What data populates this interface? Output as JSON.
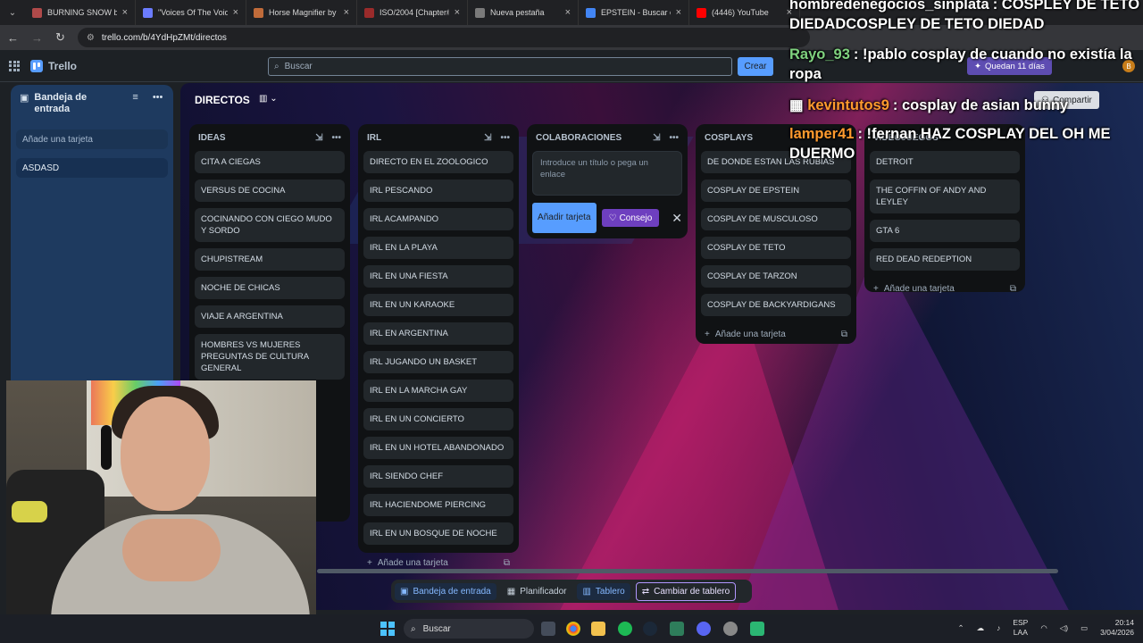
{
  "browser": {
    "tabs": [
      {
        "label": "BURNING SNOW by",
        "color": "#b04a4a"
      },
      {
        "label": "\"Voices Of The Void\"",
        "color": "#6b7cff"
      },
      {
        "label": "Horse Magnifier by w",
        "color": "#c06b3a"
      },
      {
        "label": "ISO/2004 [Chapter#1",
        "color": "#9a2b2b"
      },
      {
        "label": "Nueva pestaña",
        "color": "#7a7a7a"
      },
      {
        "label": "EPSTEIN - Buscar con",
        "color": "#4285f4"
      },
      {
        "label": "(4446) YouTube",
        "color": "#ff0000"
      }
    ],
    "url": "trello.com/b/4YdHpZMt/directos"
  },
  "trello": {
    "brand": "Trello",
    "search_placeholder": "Buscar",
    "create_label": "Crear",
    "trial_label": "Quedan 11 días",
    "share_label": "Compartir",
    "avatar_letter": "B"
  },
  "inbox": {
    "title": "Bandeja de entrada",
    "add_card": "Añade una tarjeta",
    "cards": [
      "ASDASD"
    ]
  },
  "board": {
    "title": "DIRECTOS",
    "lists": [
      {
        "title": "IDEAS",
        "cards": [
          "CITA A CIEGAS",
          "VERSUS DE COCINA",
          "COCINANDO CON CIEGO MUDO Y SORDO",
          "CHUPISTREAM",
          "NOCHE DE CHICAS",
          "VIAJE A ARGENTINA",
          "HOMBRES VS MUJERES PREGUNTAS DE CULTURA GENERAL"
        ]
      },
      {
        "title": "IRL",
        "cards": [
          "DIRECTO EN EL ZOOLOGICO",
          "IRL PESCANDO",
          "IRL ACAMPANDO",
          "IRL EN LA PLAYA",
          "IRL EN UNA FIESTA",
          "IRL EN UN KARAOKE",
          "IRL EN ARGENTINA",
          "IRL JUGANDO UN BASKET",
          "IRL EN LA MARCHA GAY",
          "IRL EN UN CONCIERTO",
          "IRL EN UN HOTEL ABANDONADO",
          "IRL SIENDO CHEF",
          "IRL HACIENDOME PIERCING",
          "IRL EN UN BOSQUE DE NOCHE"
        ],
        "add_card": "Añade una tarjeta"
      },
      {
        "title": "COLABORACIONES",
        "input_placeholder": "Introduce un título o pega un enlace",
        "add_button": "Añadir tarjeta",
        "tip_button": "Consejo"
      },
      {
        "title": "COSPLAYS",
        "cards": [
          "DE DONDE ESTAN LAS RUBIAS",
          "COSPLAY DE EPSTEIN",
          "COSPLAY DE MUSCULOSO",
          "COSPLAY DE TETO",
          "COSPLAY DE TARZON",
          "COSPLAY DE BACKYARDIGANS"
        ],
        "add_card": "Añade una tarjeta"
      },
      {
        "title": "VIDEOJUEGOS",
        "cards": [
          "DETROIT",
          "THE COFFIN OF ANDY AND LEYLEY",
          "GTA 6",
          "RED DEAD REDEPTION"
        ],
        "add_card": "Añade una tarjeta"
      }
    ]
  },
  "bottom_toolbar": {
    "inbox": "Bandeja de entrada",
    "planner": "Planificador",
    "board": "Tablero",
    "switch": "Cambiar de tablero"
  },
  "chat": [
    {
      "user": "hombredenegocios_sinplata",
      "user_color": "#ffffff",
      "text": ": COSPLEY DE TETO DIEDADCOSPLEY DE TETO DIEDAD"
    },
    {
      "user": "Rayo_93",
      "user_color": "#7fd27f",
      "text": ": !pablo cosplay de cuando no existía la ropa"
    },
    {
      "user": "kevintutos9",
      "user_color": "#ff9a2e",
      "text": ": cosplay de asian bunny"
    },
    {
      "user": "lamper41",
      "user_color": "#ff9a2e",
      "text": ": !fernan HAZ COSPLAY DEL OH ME DUERMO"
    }
  ],
  "taskbar": {
    "search": "Buscar",
    "lang": "ESP",
    "lang2": "LAA",
    "time": "20:14",
    "date": "3/04/2026"
  }
}
